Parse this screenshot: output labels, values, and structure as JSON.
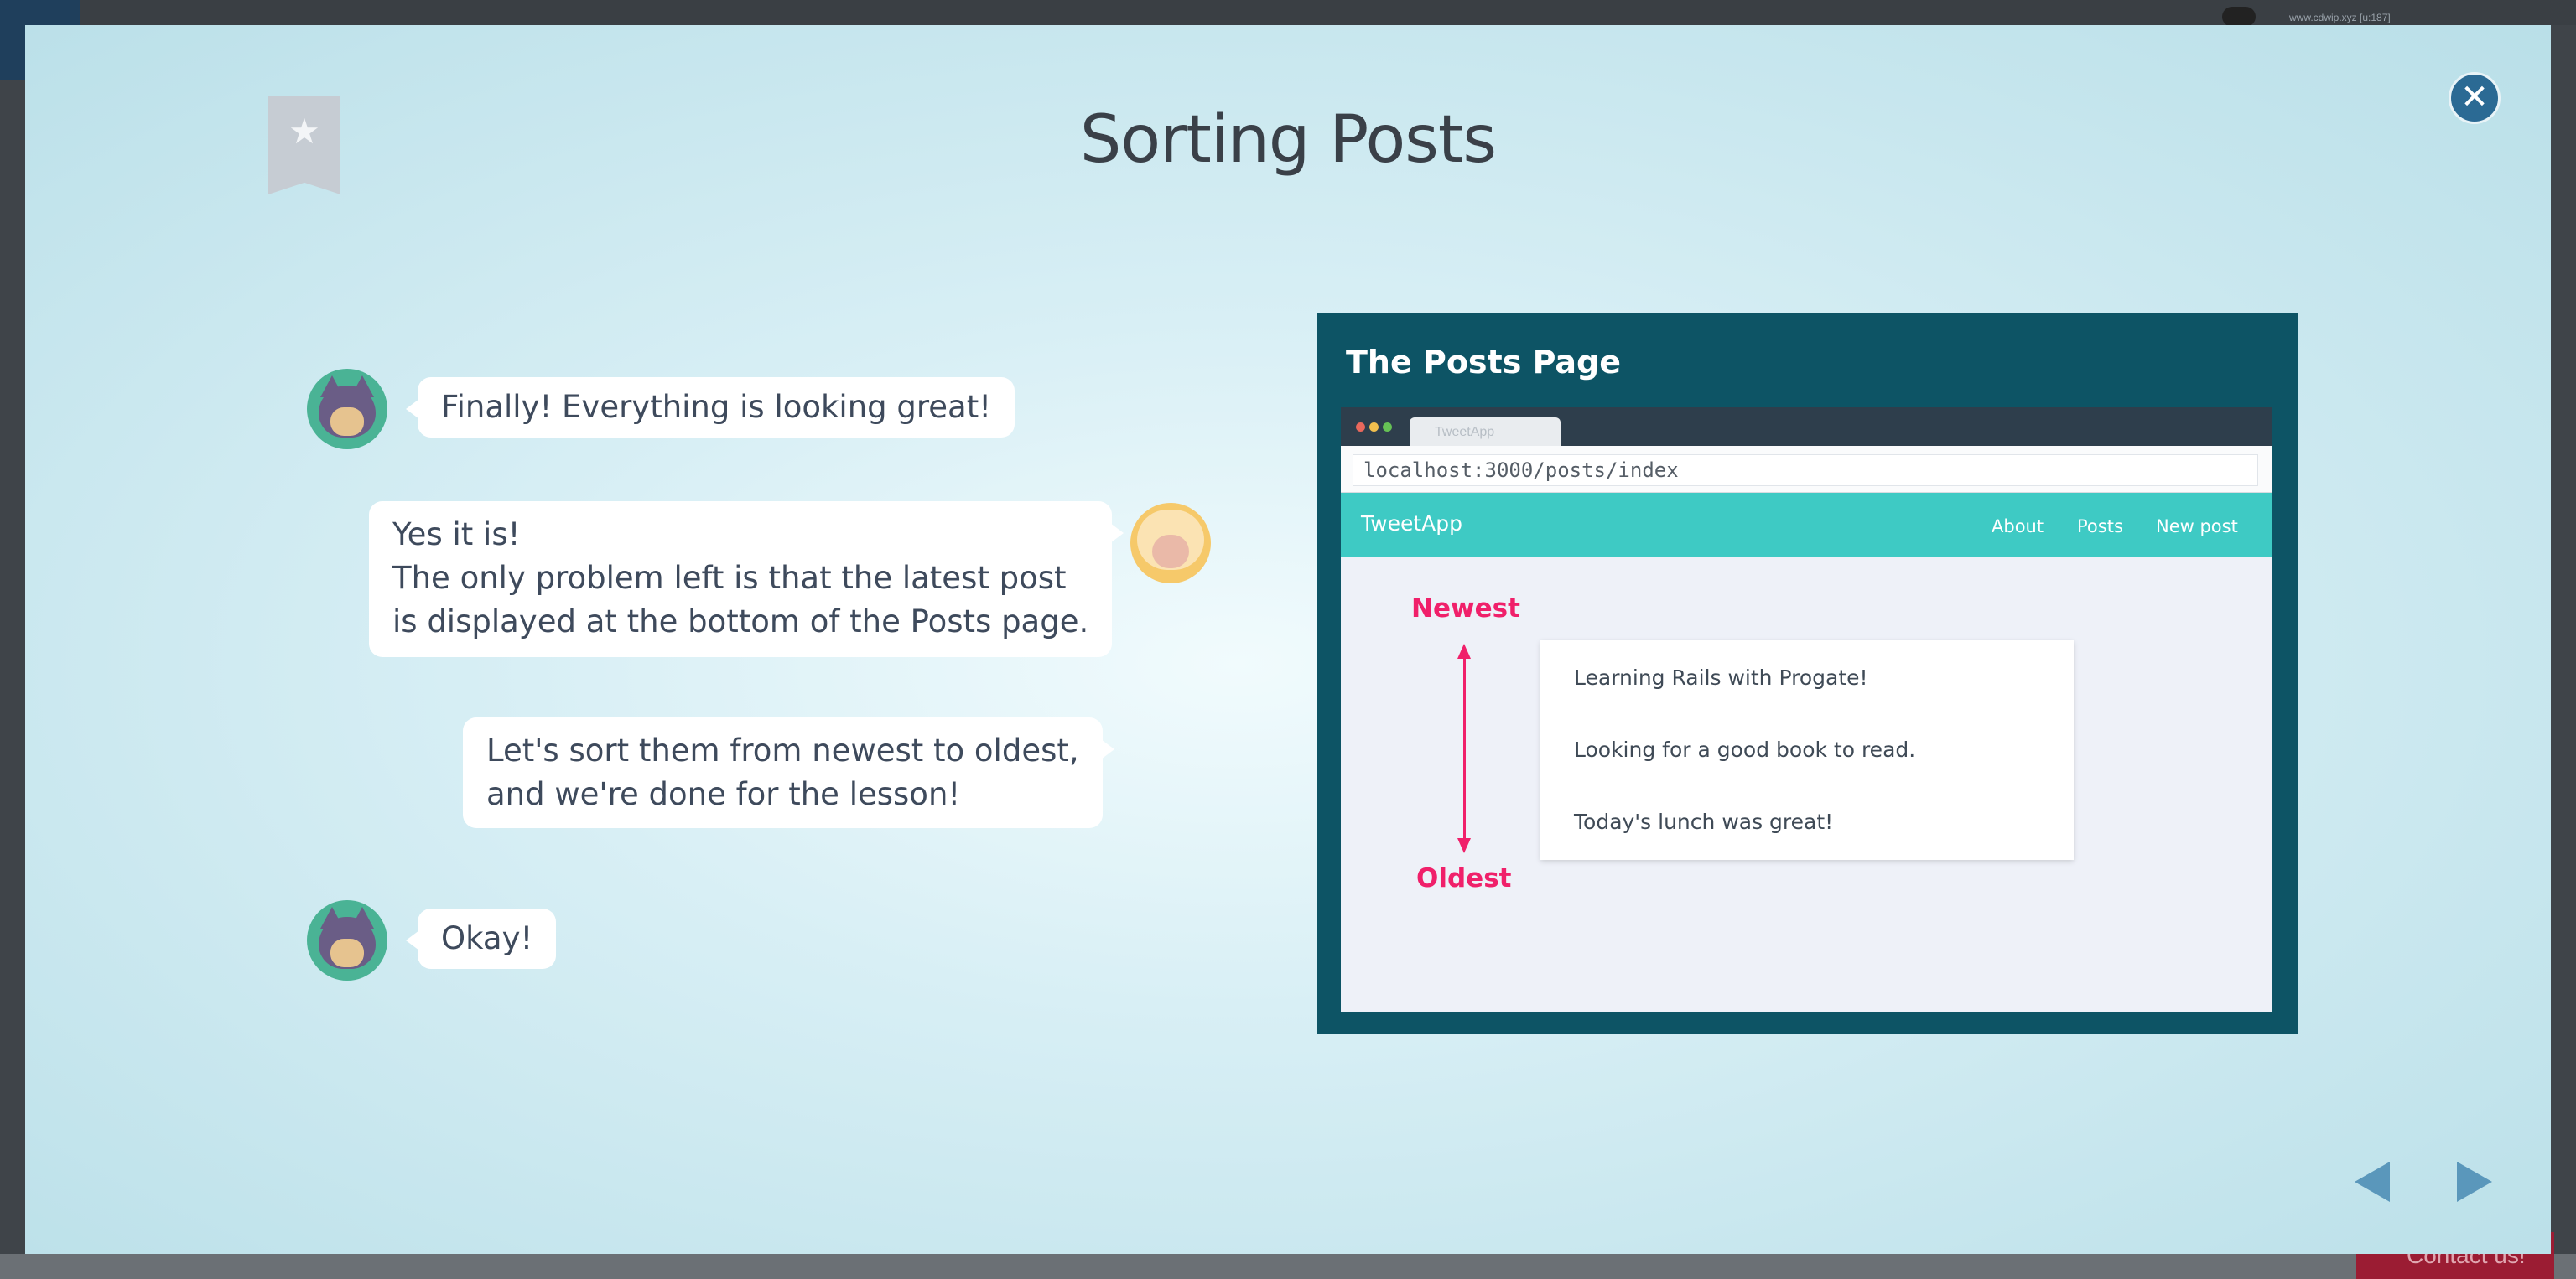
{
  "background": {
    "user_text": "www.cdwip.xyz [u:187]",
    "contact_label": "Contact us!"
  },
  "slide": {
    "title": "Sorting Posts"
  },
  "chat": [
    {
      "speaker": "cat",
      "lines": [
        "Finally! Everything is looking great!"
      ]
    },
    {
      "speaker": "sheep",
      "lines": [
        "Yes it is!",
        "The only problem left is that the latest post",
        "is displayed at the bottom of the Posts page."
      ]
    },
    {
      "speaker": "sheep",
      "lines": [
        "Let's sort them from newest to oldest,",
        "and we're done for the lesson!"
      ]
    },
    {
      "speaker": "cat",
      "lines": [
        "Okay!"
      ]
    }
  ],
  "illustration": {
    "title": "The Posts Page",
    "tab_label": "TweetApp",
    "url": "localhost:3000/posts/index",
    "app_brand": "TweetApp",
    "nav_links": [
      "About",
      "Posts",
      "New post"
    ],
    "label_newest": "Newest",
    "label_oldest": "Oldest",
    "posts": [
      "Learning Rails with Progate!",
      "Looking for a good book to read.",
      "Today's lunch was great!"
    ]
  },
  "icons": {
    "close": "close-icon",
    "bookmark": "bookmark-icon",
    "prev": "prev-arrow-icon",
    "next": "next-arrow-icon"
  },
  "colors": {
    "accent": "#2b6a94",
    "highlight": "#f0206a",
    "app_nav": "#3ecac4",
    "illustration_bg": "#0d5465"
  }
}
